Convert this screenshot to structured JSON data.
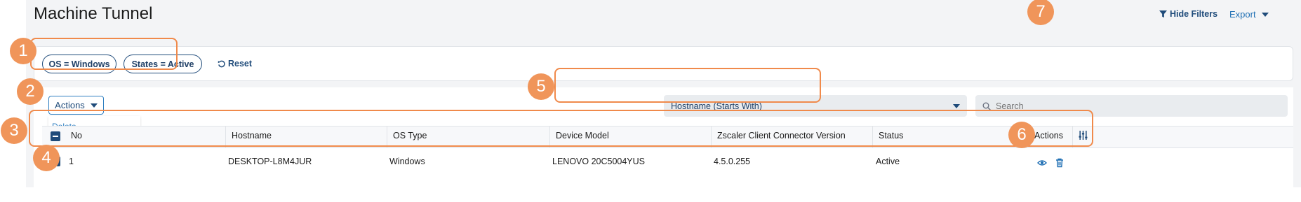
{
  "page": {
    "title": "Machine Tunnel"
  },
  "toolbar": {
    "hide_filters": "Hide Filters",
    "export": "Export"
  },
  "filters": {
    "chips": [
      "OS = Windows",
      "States = Active"
    ],
    "reset": "Reset"
  },
  "actions": {
    "label": "Actions",
    "menu": [
      "Delete"
    ]
  },
  "search": {
    "field_select": "Hostname (Starts With)",
    "placeholder": "Search",
    "value": ""
  },
  "table": {
    "columns": [
      "No",
      "Hostname",
      "OS Type",
      "Device Model",
      "Zscaler Client Connector Version",
      "Status",
      "Actions"
    ],
    "rows": [
      {
        "no": "1",
        "hostname": "DESKTOP-L8M4JUR",
        "os_type": "Windows",
        "device_model": "LENOVO 20C5004YUS",
        "version": "4.5.0.255",
        "status": "Active",
        "selected": true
      }
    ]
  },
  "annotations": [
    "1",
    "2",
    "3",
    "4",
    "5",
    "6",
    "7"
  ],
  "colors": {
    "accent": "#1f4b7a",
    "link": "#2f7fc1",
    "annotation": "#f08a4b",
    "panel": "#f3f4f6"
  },
  "icons": [
    "funnel-icon",
    "chevron-down-icon",
    "reset-icon",
    "search-icon",
    "column-settings-icon",
    "view-icon",
    "delete-icon",
    "checkbox-icon"
  ]
}
